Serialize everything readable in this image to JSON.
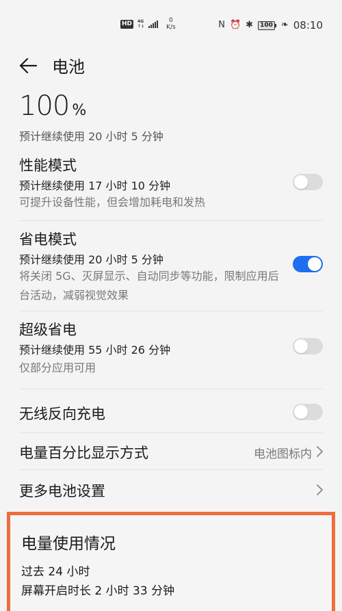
{
  "status_bar": {
    "hd": "HD",
    "network_top": "4G",
    "network_bottom": "↑↓",
    "speed_value": "0",
    "speed_unit": "K/s",
    "nfc_icon": "N",
    "alarm_icon": "⏰",
    "bluetooth_icon": "✱",
    "battery_text": "100",
    "leaf_icon": "❧",
    "time": "08:10"
  },
  "header": {
    "title": "电池"
  },
  "battery": {
    "percent": "100",
    "percent_symbol": "%",
    "estimate": "预计继续使用 20 小时 5 分钟"
  },
  "modes": [
    {
      "title": "性能模式",
      "subtitle": "预计继续使用 17 小时 10 分钟",
      "desc": "可提升设备性能，但会增加耗电和发热",
      "enabled": false
    },
    {
      "title": "省电模式",
      "subtitle": "预计继续使用 20 小时 5 分钟",
      "desc": "将关闭 5G、灭屏显示、自动同步等功能，限制应用后台活动，减弱视觉效果",
      "enabled": true
    },
    {
      "title": "超级省电",
      "subtitle": "预计继续使用 55 小时 26 分钟",
      "desc": "仅部分应用可用",
      "enabled": false
    }
  ],
  "wireless_reverse": {
    "label": "无线反向充电",
    "enabled": false
  },
  "percent_display": {
    "label": "电量百分比显示方式",
    "value": "电池图标内"
  },
  "more_settings": {
    "label": "更多电池设置"
  },
  "usage": {
    "title": "电量使用情况",
    "period": "过去 24 小时",
    "screen_on": "屏幕开启时长 2 小时 33 分钟"
  },
  "colors": {
    "accent": "#1d6ff0",
    "highlight_border": "#f06c3c"
  }
}
